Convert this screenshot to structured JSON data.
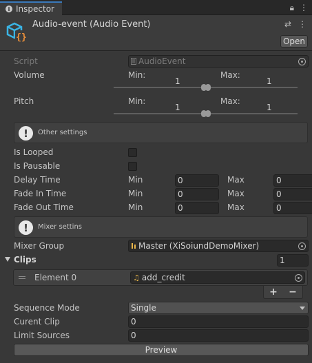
{
  "tab": {
    "label": "Inspector"
  },
  "header": {
    "title": "Audio-event (Audio Event)",
    "open_label": "Open"
  },
  "script": {
    "label": "Script",
    "value": "AudioEvent"
  },
  "volume": {
    "label": "Volume",
    "min_label": "Min:",
    "max_label": "Max:",
    "min_value": "1",
    "max_value": "1"
  },
  "pitch": {
    "label": "Pitch",
    "min_label": "Min:",
    "max_label": "Max:",
    "min_value": "1",
    "max_value": "1"
  },
  "other_settings": {
    "text": "Other settings"
  },
  "is_looped": {
    "label": "Is Looped"
  },
  "is_pausable": {
    "label": "Is Pausable"
  },
  "delay_time": {
    "label": "Delay Time",
    "min_label": "Min",
    "max_label": "Max",
    "min_value": "0",
    "max_value": "0"
  },
  "fade_in_time": {
    "label": "Fade In Time",
    "min_label": "Min",
    "max_label": "Max",
    "min_value": "0",
    "max_value": "0"
  },
  "fade_out_time": {
    "label": "Fade Out Time",
    "min_label": "Min",
    "max_label": "Max",
    "min_value": "0",
    "max_value": "0"
  },
  "mixer_settings": {
    "text": "Mixer settins"
  },
  "mixer_group": {
    "label": "Mixer Group",
    "value": "Master (XiSoiundDemoMixer)"
  },
  "clips": {
    "label": "Clips",
    "count": "1",
    "elements": [
      {
        "label": "Element 0",
        "value": "add_credit"
      }
    ]
  },
  "sequence_mode": {
    "label": "Sequence Mode",
    "value": "Single"
  },
  "current_clip": {
    "label": "Curent Clip",
    "value": "0"
  },
  "limit_sources": {
    "label": "Limit Sources",
    "value": "0"
  },
  "preview": {
    "label": "Preview"
  },
  "colors": {
    "background": "#383838",
    "field": "#2a2a2a",
    "tab_accent": "#3a79bb",
    "icon_cyan": "#3ab4e4",
    "icon_orange": "#f0923a",
    "audio_icon": "#e8b64a"
  }
}
